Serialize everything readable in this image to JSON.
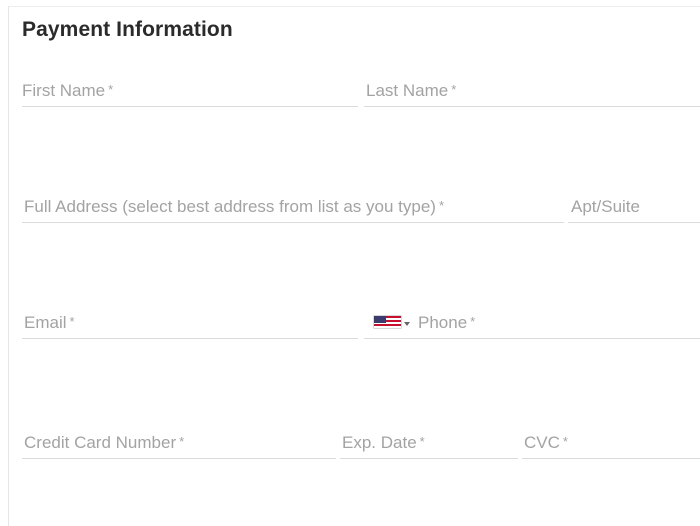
{
  "form": {
    "title": "Payment Information",
    "required_mark": "*",
    "fields": {
      "first_name": {
        "placeholder": "First Name",
        "value": ""
      },
      "last_name": {
        "placeholder": "Last Name",
        "value": ""
      },
      "full_address": {
        "placeholder": "Full Address (select best address from list as you type)",
        "value": ""
      },
      "apt_suite": {
        "placeholder": "Apt/Suite",
        "value": ""
      },
      "email": {
        "placeholder": "Email",
        "value": ""
      },
      "phone": {
        "placeholder": "Phone",
        "value": "",
        "country_flag_icon": "us-flag-icon",
        "dropdown_icon": "caret-down-icon"
      },
      "card_number": {
        "placeholder": "Credit Card Number",
        "value": ""
      },
      "exp_date": {
        "placeholder": "Exp. Date",
        "value": ""
      },
      "cvc": {
        "placeholder": "CVC",
        "value": ""
      }
    }
  },
  "colors": {
    "title": "#2b2b2b",
    "placeholder": "#a3a3a3",
    "underline": "#dcdcdc",
    "flag_red": "#c8102e",
    "flag_blue": "#3c3b6e"
  }
}
